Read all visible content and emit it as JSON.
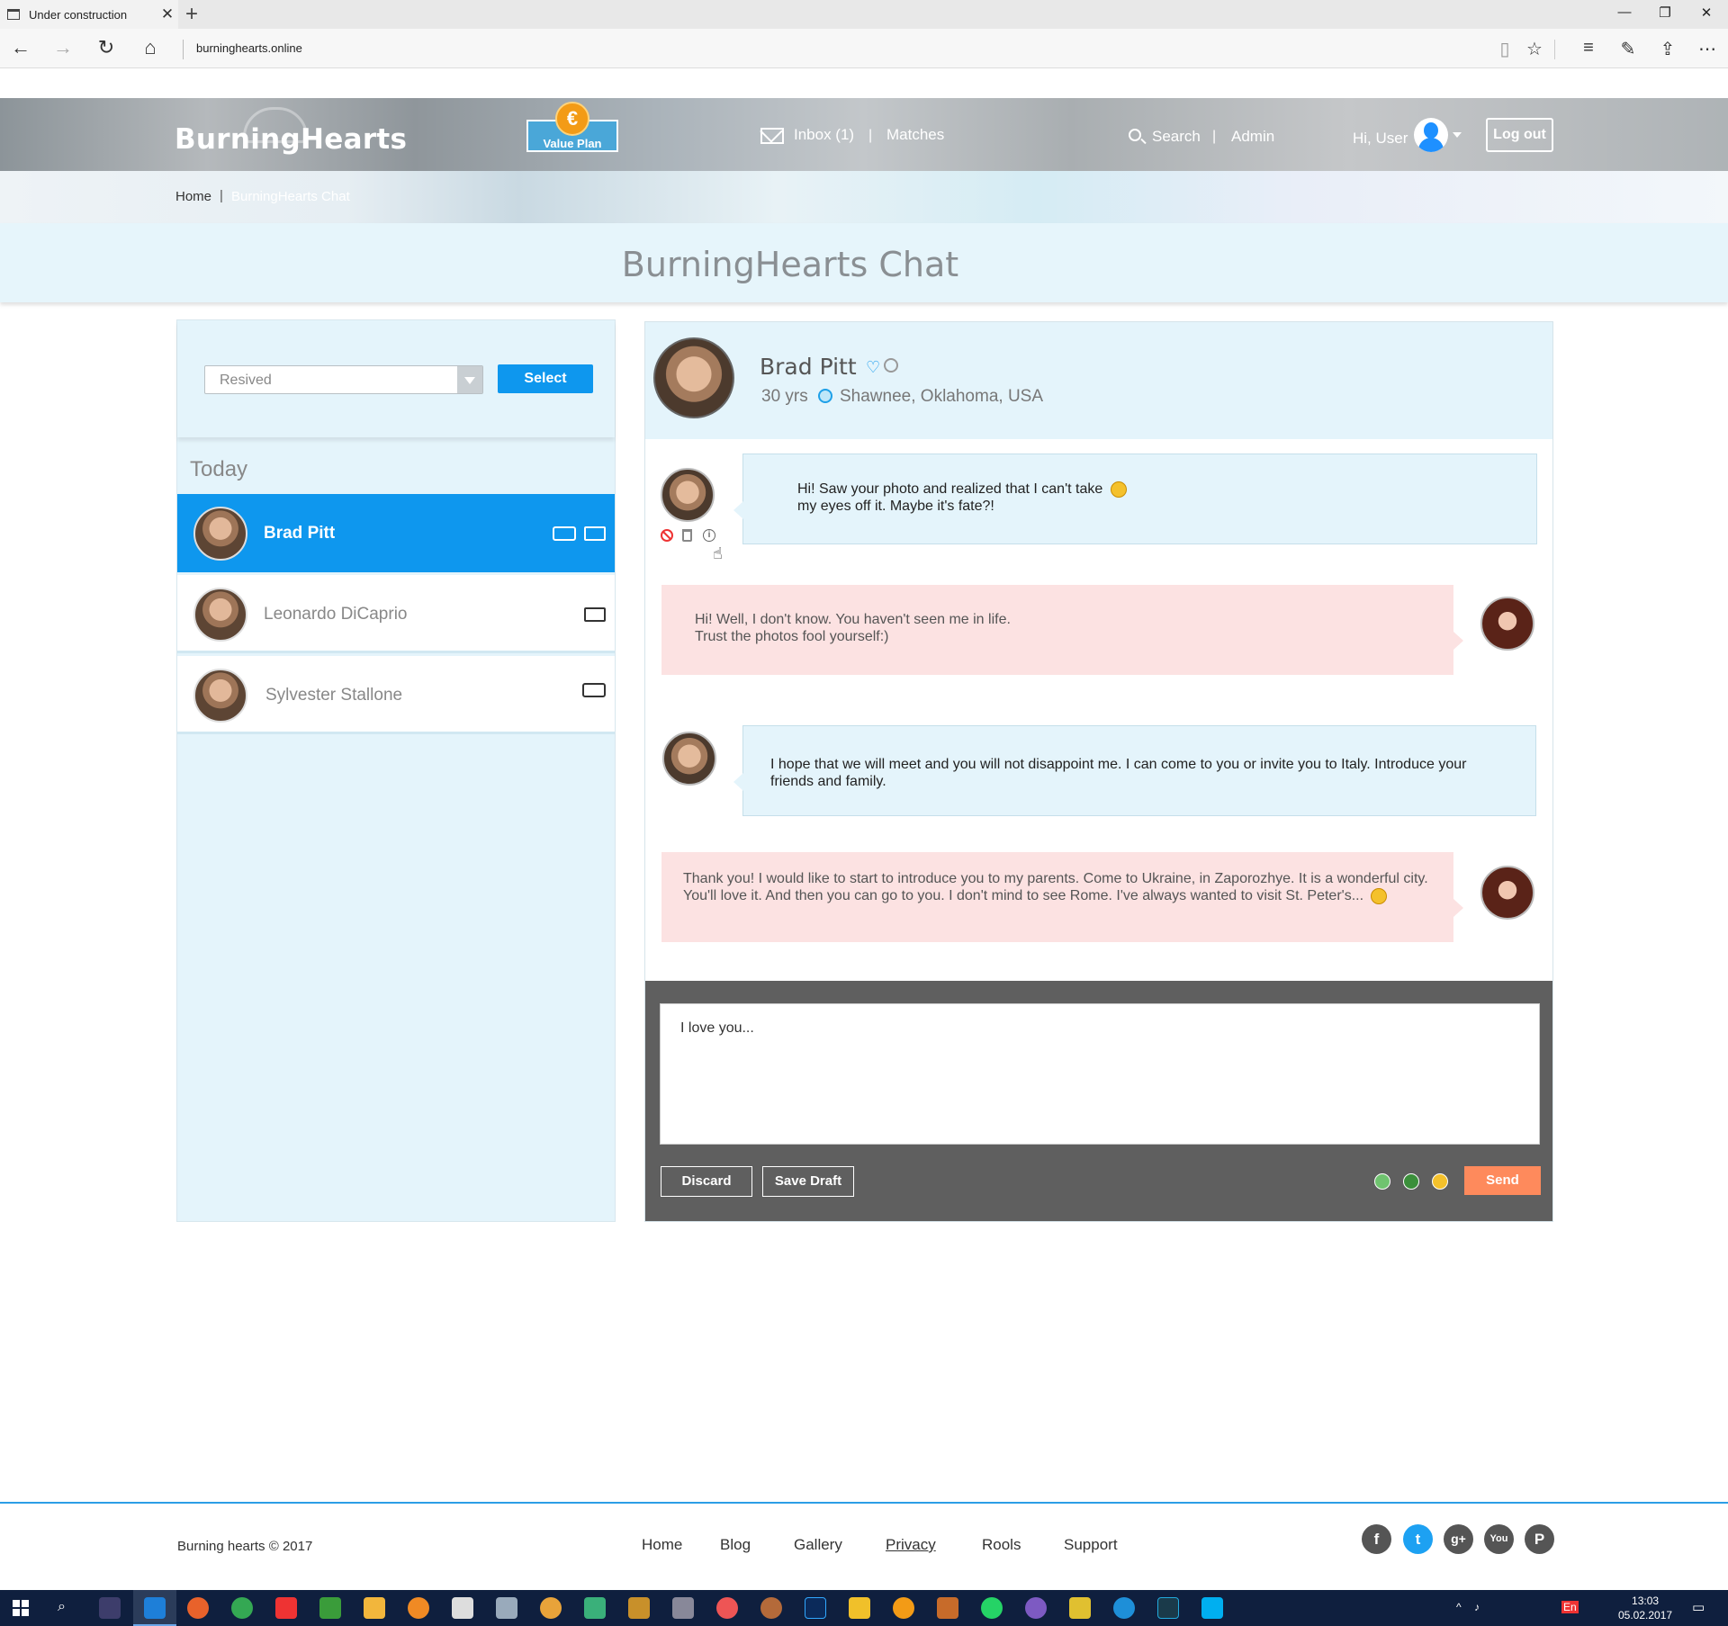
{
  "browser": {
    "tab_title": "Under construction",
    "url": "burninghearts.online"
  },
  "header": {
    "logo": "BurningHearts",
    "value_plan_label": "Value Plan",
    "value_plan_symbol": "€",
    "inbox_label": "Inbox (1)",
    "matches_label": "Matches",
    "search_label": "Search",
    "admin_label": "Admin",
    "greeting": "Hi, User",
    "logout_label": "Log out",
    "accent_color": "#0e97ee"
  },
  "breadcrumb": {
    "home": "Home",
    "current": "BurningHearts Chat"
  },
  "page_title": "BurningHearts Chat",
  "sidebar": {
    "filter_value": "Resived",
    "select_label": "Select",
    "section_label": "Today",
    "contacts": [
      {
        "name": "Brad Pitt",
        "active": true,
        "icons": [
          "chat-icon",
          "envelope-icon"
        ]
      },
      {
        "name": "Leonardo DiCaprio",
        "active": false,
        "icons": [
          "envelope-icon"
        ]
      },
      {
        "name": "Sylvester Stallone",
        "active": false,
        "icons": [
          "chat-icon"
        ]
      }
    ]
  },
  "chat": {
    "profile": {
      "name": "Brad Pitt",
      "age": "30 yrs",
      "location": "Shawnee, Oklahoma, USA"
    },
    "messages": [
      {
        "from": "him",
        "text": "Hi! Saw your photo and realized that I can't take my eyes off it. Maybe it's fate?!"
      },
      {
        "from": "me",
        "text": "Hi! Well, I don't know. You haven't seen me in life. Trust the photos fool yourself:)"
      },
      {
        "from": "him",
        "text": "I hope that we will meet and you will not disappoint me. I can come to you or invite you to Italy. Introduce your friends and family."
      },
      {
        "from": "me",
        "text": "Thank you! I would like to start to introduce you to my parents. Come to Ukraine, in Zaporozhye. It is a wonderful city. You'll love it. And then you can go to you. I don't mind to see Rome. I've always wanted to visit St. Peter's..."
      }
    ],
    "draft": "I love you...",
    "discard_label": "Discard",
    "save_draft_label": "Save Draft",
    "send_label": "Send",
    "send_color": "#fe8a5c"
  },
  "footer": {
    "copyright": "Burning hearts © 2017",
    "links": [
      "Home",
      "Blog",
      "Gallery",
      "Privacy",
      "Rools",
      "Support"
    ],
    "social": [
      "f",
      "t",
      "g+",
      "You",
      "P"
    ]
  },
  "taskbar": {
    "time": "13:03",
    "date": "05.02.2017",
    "lang": "En"
  }
}
